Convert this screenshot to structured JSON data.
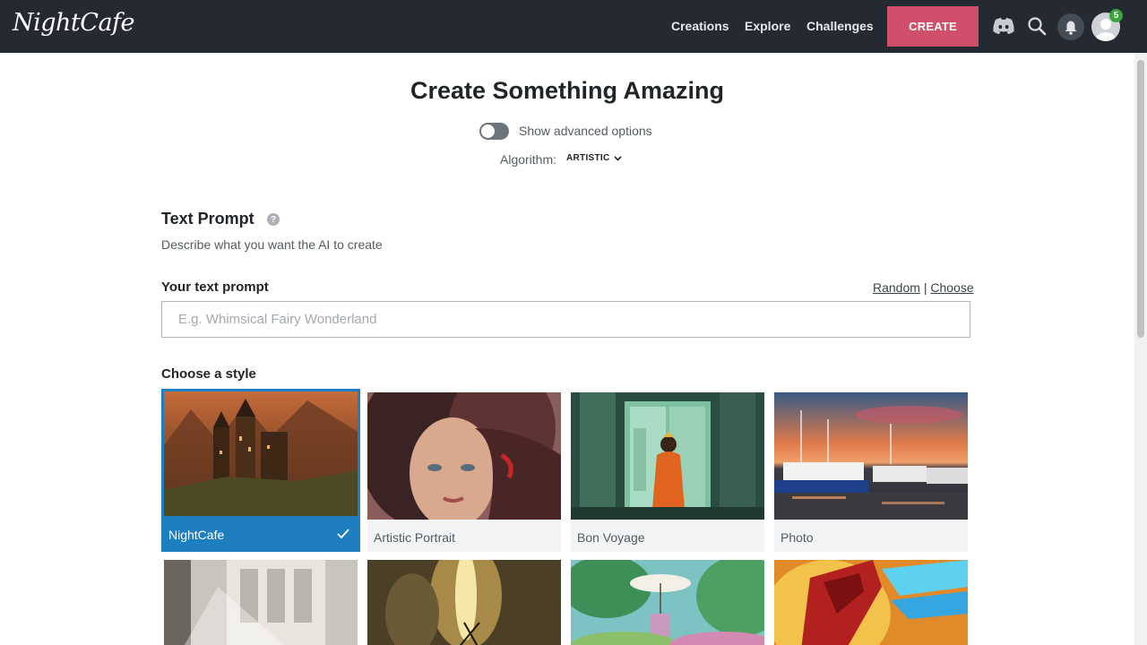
{
  "nav": {
    "logo": "NightCafe",
    "links": [
      "Creations",
      "Explore",
      "Challenges"
    ],
    "create_label": "CREATE",
    "avatar_badge": "5",
    "icons": [
      "discord-icon",
      "search-icon",
      "bell-icon",
      "avatar"
    ]
  },
  "header": {
    "title": "Create Something Amazing",
    "advanced_toggle_label": "Show advanced options",
    "advanced_toggle_on": false,
    "algorithm_label": "Algorithm:",
    "algorithm_value": "ARTISTIC"
  },
  "prompt_section": {
    "title": "Text Prompt",
    "description": "Describe what you want the AI to create",
    "field_label": "Your text prompt",
    "random_link": "Random",
    "separator": "|",
    "choose_link": "Choose",
    "placeholder": "E.g. Whimsical Fairy Wonderland",
    "value": ""
  },
  "styles": {
    "label": "Choose a style",
    "selected": "NightCafe",
    "items": [
      {
        "name": "NightCafe"
      },
      {
        "name": "Artistic Portrait"
      },
      {
        "name": "Bon Voyage"
      },
      {
        "name": "Photo"
      }
    ]
  },
  "colors": {
    "navbar": "#252a32",
    "create_button": "#d0506a",
    "selected_card": "#1e7fc0",
    "badge": "#3aa63a"
  }
}
